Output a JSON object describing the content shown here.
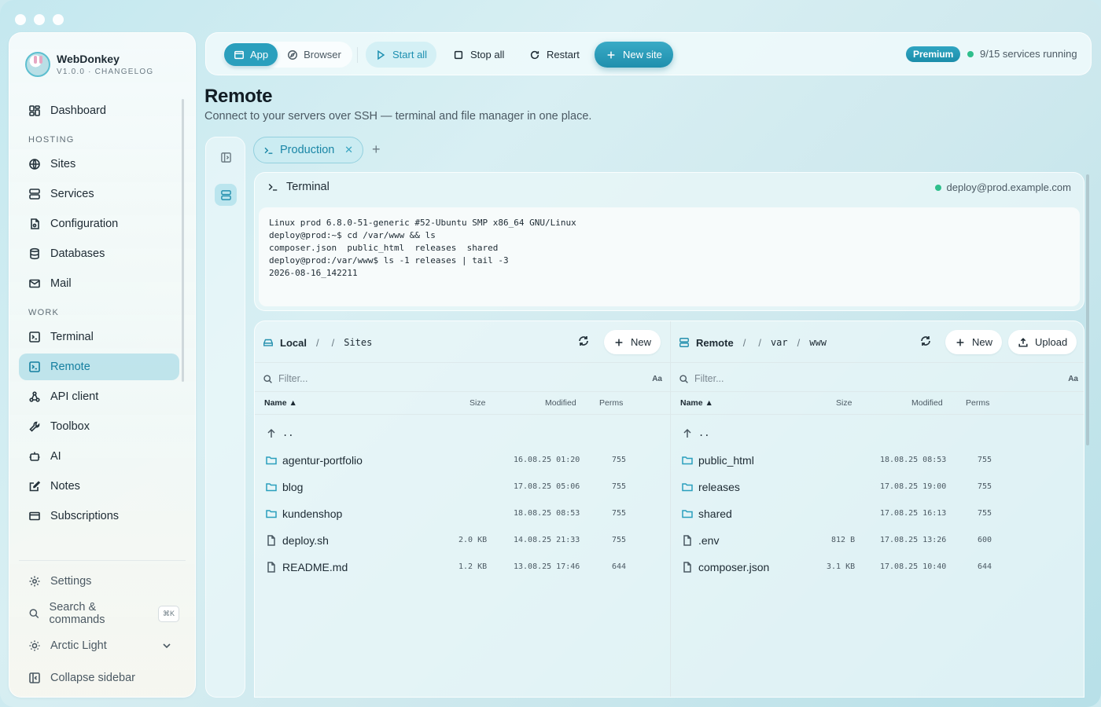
{
  "app": {
    "name": "WebDonkey",
    "version": "V1.0.0 · CHANGELOG"
  },
  "sidebar": {
    "dashboard": "Dashboard",
    "hosting_label": "HOSTING",
    "hosting": [
      {
        "label": "Sites",
        "icon": "globe-icon"
      },
      {
        "label": "Services",
        "icon": "server-icon"
      },
      {
        "label": "Configuration",
        "icon": "config-file-icon"
      },
      {
        "label": "Databases",
        "icon": "database-icon"
      },
      {
        "label": "Mail",
        "icon": "mail-icon"
      }
    ],
    "work_label": "WORK",
    "work": [
      {
        "label": "Terminal",
        "icon": "terminal-icon"
      },
      {
        "label": "Remote",
        "icon": "remote-terminal-icon",
        "active": true
      },
      {
        "label": "API client",
        "icon": "api-icon"
      },
      {
        "label": "Toolbox",
        "icon": "wrench-icon"
      },
      {
        "label": "AI",
        "icon": "robot-icon"
      },
      {
        "label": "Notes",
        "icon": "notes-icon"
      },
      {
        "label": "Subscriptions",
        "icon": "card-icon"
      }
    ],
    "settings": "Settings",
    "search": "Search & commands",
    "search_kbd": "⌘K",
    "theme": "Arctic Light",
    "collapse": "Collapse sidebar"
  },
  "toolbar": {
    "mode_app": "App",
    "mode_browser": "Browser",
    "start_all": "Start all",
    "stop_all": "Stop all",
    "restart": "Restart",
    "new_site": "New site",
    "premium": "Premium",
    "services_status": "9/15 services running"
  },
  "page": {
    "title": "Remote",
    "subtitle": "Connect to your servers over SSH — terminal and file manager in one place."
  },
  "session_tab": {
    "label": "Production",
    "add": "+"
  },
  "terminal": {
    "title": "Terminal",
    "host": "deploy@prod.example.com",
    "lines": [
      "Linux prod 6.8.0-51-generic #52-Ubuntu SMP x86_64 GNU/Linux",
      "",
      "deploy@prod:~$ cd /var/www && ls",
      "composer.json  public_html  releases  shared",
      "",
      "deploy@prod:/var/www$ ls -1 releases | tail -3",
      "2026-08-16_142211"
    ]
  },
  "local_pane": {
    "root": "Local",
    "sep": "/",
    "path_seg": "Sites",
    "new_label": "New",
    "filter_placeholder": "Filter...",
    "case_toggle": "Aa",
    "columns": {
      "name": "Name ▲",
      "size": "Size",
      "modified": "Modified",
      "perms": "Perms"
    },
    "parent": "..",
    "rows": [
      {
        "name": "agentur-portfolio",
        "type": "folder",
        "size": "",
        "modified": "16.08.25 01:20",
        "perms": "755"
      },
      {
        "name": "blog",
        "type": "folder",
        "size": "",
        "modified": "17.08.25 05:06",
        "perms": "755"
      },
      {
        "name": "kundenshop",
        "type": "folder",
        "size": "",
        "modified": "18.08.25 08:53",
        "perms": "755"
      },
      {
        "name": "deploy.sh",
        "type": "file",
        "size": "2.0 KB",
        "modified": "14.08.25 21:33",
        "perms": "755"
      },
      {
        "name": "README.md",
        "type": "file",
        "size": "1.2 KB",
        "modified": "13.08.25 17:46",
        "perms": "644"
      }
    ]
  },
  "remote_pane": {
    "root": "Remote",
    "sep": "/",
    "path_seg1": "var",
    "path_seg2": "www",
    "new_label": "New",
    "upload_label": "Upload",
    "filter_placeholder": "Filter...",
    "case_toggle": "Aa",
    "columns": {
      "name": "Name ▲",
      "size": "Size",
      "modified": "Modified",
      "perms": "Perms"
    },
    "parent": "..",
    "rows": [
      {
        "name": "public_html",
        "type": "folder",
        "size": "",
        "modified": "18.08.25 08:53",
        "perms": "755"
      },
      {
        "name": "releases",
        "type": "folder",
        "size": "",
        "modified": "17.08.25 19:00",
        "perms": "755"
      },
      {
        "name": "shared",
        "type": "folder",
        "size": "",
        "modified": "17.08.25 16:13",
        "perms": "755"
      },
      {
        "name": ".env",
        "type": "file",
        "size": "812 B",
        "modified": "17.08.25 13:26",
        "perms": "600"
      },
      {
        "name": "composer.json",
        "type": "file",
        "size": "3.1 KB",
        "modified": "17.08.25 10:40",
        "perms": "644"
      }
    ]
  },
  "colors": {
    "accent": "#2a9fbd",
    "status_ok": "#2fbf8c"
  }
}
